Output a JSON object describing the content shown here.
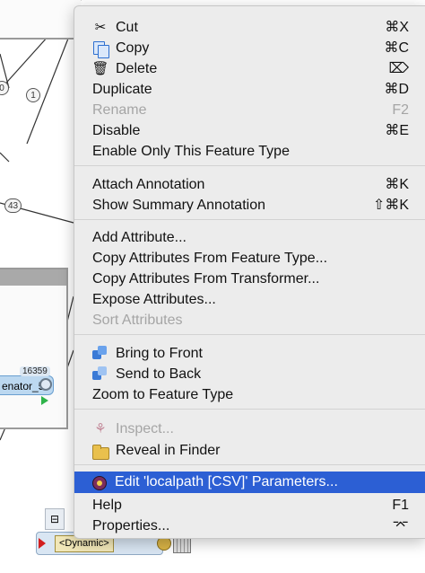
{
  "canvas": {
    "badges": [
      "0",
      "1",
      "43"
    ],
    "node_count": "16359",
    "node_label": "enator_5",
    "dynamic_label": "<Dynamic>"
  },
  "menu": {
    "groups": [
      [
        {
          "label": "Cut",
          "shortcut": "⌘X",
          "icon": "scissors-icon"
        },
        {
          "label": "Copy",
          "shortcut": "⌘C",
          "icon": "copy-icon"
        },
        {
          "label": "Delete",
          "shortcut": "⌦",
          "icon": "trash-icon"
        },
        {
          "label": "Duplicate",
          "shortcut": "⌘D"
        },
        {
          "label": "Rename",
          "shortcut": "F2",
          "disabled": true
        },
        {
          "label": "Disable",
          "shortcut": "⌘E"
        },
        {
          "label": "Enable Only This Feature Type",
          "shortcut": ""
        }
      ],
      [
        {
          "label": "Attach Annotation",
          "shortcut": "⌘K"
        },
        {
          "label": "Show Summary Annotation",
          "shortcut": "⇧⌘K"
        }
      ],
      [
        {
          "label": "Add Attribute...",
          "shortcut": ""
        },
        {
          "label": "Copy Attributes From Feature Type...",
          "shortcut": ""
        },
        {
          "label": "Copy Attributes From Transformer...",
          "shortcut": ""
        },
        {
          "label": "Expose Attributes...",
          "shortcut": ""
        },
        {
          "label": "Sort Attributes",
          "shortcut": "",
          "disabled": true
        }
      ],
      [
        {
          "label": "Bring to Front",
          "shortcut": "",
          "icon": "bring-to-front-icon"
        },
        {
          "label": "Send to Back",
          "shortcut": "",
          "icon": "send-to-back-icon"
        },
        {
          "label": "Zoom to Feature Type",
          "shortcut": ""
        }
      ],
      [
        {
          "label": "Inspect...",
          "shortcut": "",
          "icon": "inspect-icon",
          "disabled": true
        },
        {
          "label": "Reveal in Finder",
          "shortcut": "",
          "icon": "folder-icon"
        }
      ],
      [
        {
          "label": "Edit 'localpath [CSV]' Parameters...",
          "shortcut": "",
          "icon": "edit-parameters-icon",
          "highlight": true
        },
        {
          "label": "Help",
          "shortcut": "F1"
        },
        {
          "label": "Properties...",
          "shortcut": "⌤"
        }
      ]
    ]
  },
  "colors": {
    "menu_bg": "#ececec",
    "highlight": "#2c5fd4",
    "disabled_text": "#a5a5a5"
  }
}
